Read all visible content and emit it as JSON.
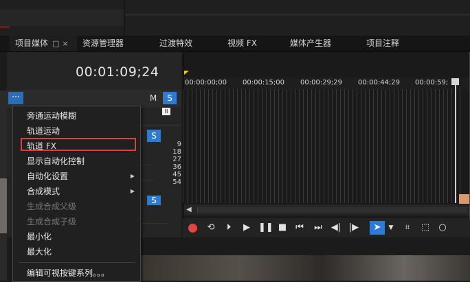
{
  "tabs": [
    {
      "label": "项目媒体",
      "active": true
    },
    {
      "label": "资源管理器"
    },
    {
      "label": "过渡特效"
    },
    {
      "label": "视频 FX"
    },
    {
      "label": "媒体产生器"
    },
    {
      "label": "项目注释"
    }
  ],
  "tab_icons": {
    "maximize": "□",
    "close": "×"
  },
  "timecode": "00:01:09;24",
  "track": {
    "dots_label": "···",
    "mute_label": "M",
    "solo_label": "S",
    "mini_label": "II",
    "numbers": [
      "9",
      "18",
      "27",
      "36",
      "45",
      "54"
    ]
  },
  "ruler": {
    "labels": [
      "00:00:00;00",
      "00:00:15;00",
      "00:00:29;29",
      "00:00:44;29",
      "00:00:59;"
    ]
  },
  "context_menu": {
    "items": [
      {
        "label": "旁通运动模糊"
      },
      {
        "label": "轨道运动"
      },
      {
        "label": "轨道 FX",
        "highlighted": true
      },
      {
        "label": "显示自动化控制"
      },
      {
        "label": "自动化设置",
        "submenu": true
      },
      {
        "label": "合成模式",
        "submenu": true
      },
      {
        "label": "生成合成父级",
        "disabled": true
      },
      {
        "label": "生成合成子级",
        "disabled": true
      },
      {
        "label": "最小化"
      },
      {
        "label": "最大化"
      },
      {
        "label": "编辑可视按键系列。。。"
      }
    ]
  },
  "colors": {
    "accent": "#2e7bd6",
    "highlight_border": "#e0403c",
    "record": "#e5453f",
    "marker": "#f0d000"
  },
  "transport": {
    "icons": [
      "record-icon",
      "loop-icon",
      "play-from-start-icon",
      "play-icon",
      "pause-icon",
      "stop-icon",
      "go-to-start-icon",
      "go-to-end-icon",
      "prev-frame-icon",
      "next-frame-icon",
      "select-tool-icon",
      "dropdown-icon",
      "envelope-tool-icon",
      "selection-box-icon",
      "zoom-icon"
    ]
  }
}
